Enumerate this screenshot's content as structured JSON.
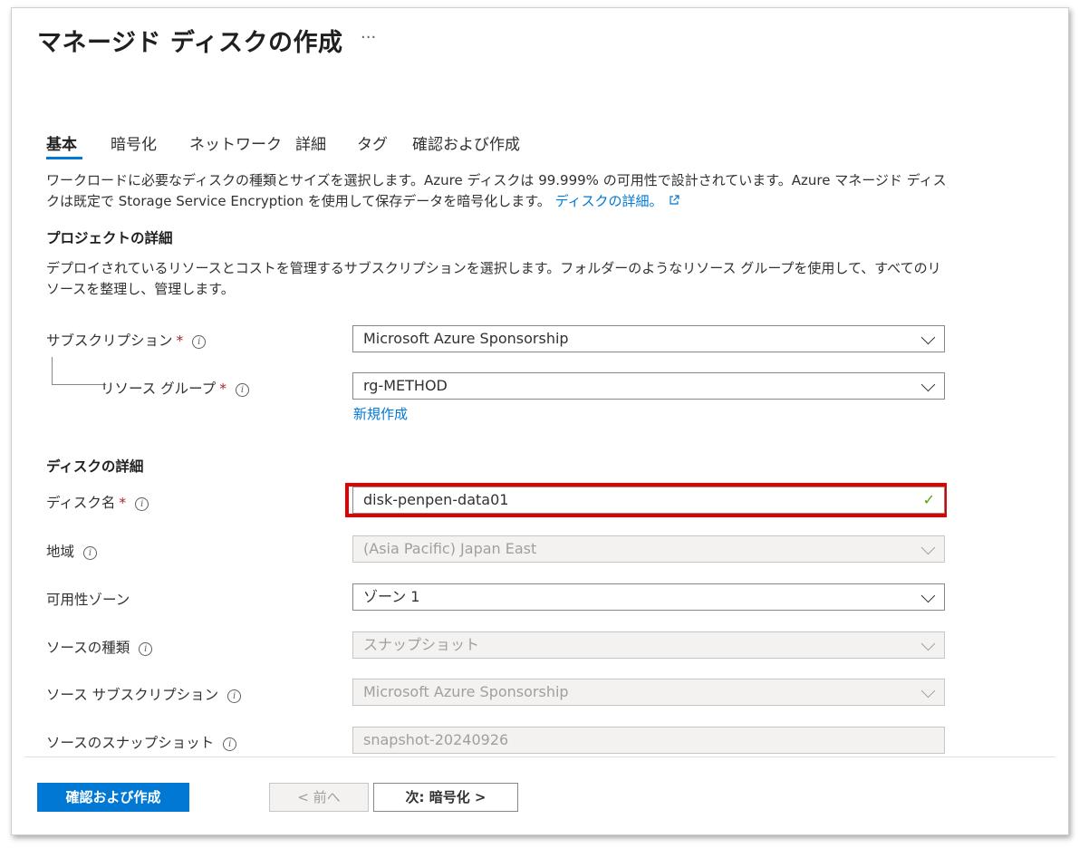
{
  "header": {
    "title": "マネージド ディスクの作成",
    "more_label": "···"
  },
  "tabs": [
    "基本",
    "暗号化",
    "ネットワーク",
    "詳細",
    "タグ",
    "確認および作成"
  ],
  "intro": {
    "text": "ワークロードに必要なディスクの種類とサイズを選択します。Azure ディスクは 99.999% の可用性で設計されています。Azure マネージド ディスクは既定で Storage Service Encryption を使用して保存データを暗号化します。",
    "link": "ディスクの詳細。",
    "link_icon": "external-link-icon"
  },
  "project": {
    "heading": "プロジェクトの詳細",
    "description": "デプロイされているリソースとコストを管理するサブスクリプションを選択します。フォルダーのようなリソース グループを使用して、すべてのリソースを整理し、管理します。",
    "subscription_label": "サブスクリプション",
    "subscription_value": "Microsoft Azure Sponsorship",
    "resource_group_label": "リソース グループ",
    "resource_group_value": "rg-METHOD",
    "create_new_link": "新規作成"
  },
  "disk": {
    "heading": "ディスクの詳細",
    "name_label": "ディスク名",
    "name_value": "disk-penpen-data01",
    "region_label": "地域",
    "region_value": "(Asia Pacific) Japan East",
    "zone_label": "可用性ゾーン",
    "zone_value": "ゾーン 1",
    "source_type_label": "ソースの種類",
    "source_type_value": "スナップショット",
    "source_subscription_label": "ソース サブスクリプション",
    "source_subscription_value": "Microsoft Azure Sponsorship",
    "source_snapshot_label": "ソースのスナップショット",
    "source_snapshot_value": "snapshot-20240926"
  },
  "required_mark": "*",
  "info_glyph": "i",
  "valid_glyph": "✓",
  "footer": {
    "review_create": "確認および作成",
    "previous": "< 前へ",
    "next": "次: 暗号化 >"
  },
  "colors": {
    "accent": "#0078d4",
    "highlight": "#e00000",
    "valid": "#57a300",
    "required": "#a4262c"
  }
}
